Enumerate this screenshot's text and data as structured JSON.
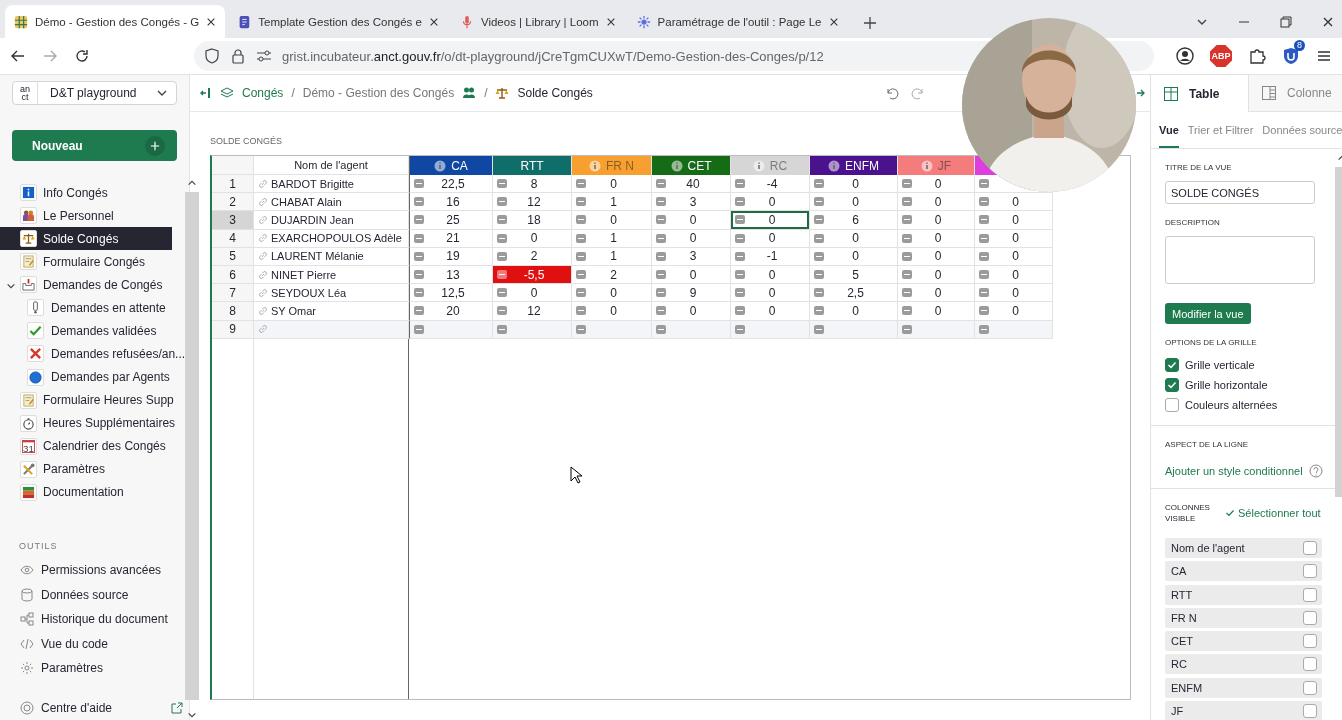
{
  "browser": {
    "tabs": [
      {
        "kind": "grid",
        "title": "Démo - Gestion des Congés - G",
        "selected": true
      },
      {
        "kind": "doc",
        "title": "Template Gestion des Congés e",
        "selected": false
      },
      {
        "kind": "mic",
        "title": "Videos | Library | Loom",
        "selected": false
      },
      {
        "kind": "sun",
        "title": "Paramétrage de l'outil : Page Le",
        "selected": false
      }
    ],
    "url": {
      "prefix": "grist.incubateur.",
      "domain": "anct.gouv.fr",
      "path": "/o/dt-playground/jCreTgmCUXwT/Demo-Gestion-des-Conges/p/12"
    },
    "adblock_label": "ABP",
    "extension_badge": "8"
  },
  "sidebar": {
    "logo": [
      "an",
      "ct"
    ],
    "org": "D&T playground",
    "new_button": "Nouveau",
    "pages": [
      {
        "kind": "info",
        "label": "Info Congés",
        "selected": false
      },
      {
        "kind": "people",
        "label": "Le Personnel",
        "selected": false
      },
      {
        "kind": "scale",
        "label": "Solde Congés",
        "selected": true
      },
      {
        "kind": "form",
        "label": "Formulaire Congés",
        "selected": false
      },
      {
        "kind": "inbox",
        "label": "Demandes de Congés",
        "selected": false,
        "expanded": true,
        "children": [
          {
            "kind": "exclaim",
            "label": "Demandes en attente",
            "selected": false
          },
          {
            "kind": "check",
            "label": "Demandes validées",
            "selected": false
          },
          {
            "kind": "cross",
            "label": "Demandes refusées/an...",
            "selected": false
          },
          {
            "kind": "circle",
            "label": "Demandes par Agents",
            "selected": false
          }
        ]
      },
      {
        "kind": "form",
        "label": "Formulaire Heures Supp",
        "selected": false
      },
      {
        "kind": "stopwatch",
        "label": "Heures Supplémentaires",
        "selected": false
      },
      {
        "kind": "calendar",
        "icon_text": "31",
        "label": "Calendrier des Congés",
        "selected": false
      },
      {
        "kind": "tools",
        "label": "Paramètres",
        "selected": false
      },
      {
        "kind": "books",
        "label": "Documentation",
        "selected": false
      }
    ],
    "tools_heading": "OUTILS",
    "tools": [
      {
        "kind": "eye",
        "label": "Permissions avancées"
      },
      {
        "kind": "database",
        "label": "Données source"
      },
      {
        "kind": "history",
        "label": "Historique du document"
      },
      {
        "kind": "code",
        "label": "Vue du code"
      },
      {
        "kind": "gear",
        "label": "Paramètres"
      }
    ],
    "help": "Centre d'aide"
  },
  "toolbar": {
    "crumbs": [
      {
        "kind": "workspace",
        "label": "Congés"
      },
      {
        "kind": "doc",
        "label": "Démo - Gestion des Congés"
      },
      {
        "kind": "page",
        "label": "Solde Congés"
      }
    ],
    "separators": [
      "/",
      "/"
    ]
  },
  "section_title": "SOLDE CONGÉS",
  "grid": {
    "columns": [
      {
        "kind": "text",
        "label": "Nom de l'agent"
      },
      {
        "kind": "number",
        "label": "CA",
        "color": "#0f47a3",
        "info": true,
        "faded": false
      },
      {
        "kind": "number",
        "label": "RTT",
        "color": "#0f6e6a",
        "info": false,
        "faded": false
      },
      {
        "kind": "number",
        "label": "FR N",
        "color": "#f7a030",
        "info": true,
        "faded": true
      },
      {
        "kind": "number",
        "label": "CET",
        "color": "#156b16",
        "info": true,
        "faded": false
      },
      {
        "kind": "number",
        "label": "RC",
        "color": "#d6d6d6",
        "info": true,
        "faded": true
      },
      {
        "kind": "number",
        "label": "ENFM",
        "color": "#4b128d",
        "info": true,
        "faded": false
      },
      {
        "kind": "number",
        "label": "JF",
        "color": "#f47c7c",
        "info": true,
        "faded": true
      },
      {
        "kind": "number",
        "color": "#dc3fdc"
      }
    ],
    "rows": [
      {
        "num": "1",
        "kind": "record",
        "selected": false,
        "cells": [
          {
            "value": "BARDOT  Brigitte",
            "alert": false,
            "focused": false
          },
          {
            "value": "22,5",
            "alert": false,
            "focused": false
          },
          {
            "value": "8",
            "alert": false,
            "focused": false
          },
          {
            "value": "0",
            "alert": false,
            "focused": false
          },
          {
            "value": "40",
            "alert": false,
            "focused": false
          },
          {
            "value": "-4",
            "alert": false,
            "focused": false
          },
          {
            "value": "0",
            "alert": false,
            "focused": false
          },
          {
            "value": "0",
            "alert": false,
            "focused": false
          },
          {
            "alert": false,
            "focused": false
          }
        ]
      },
      {
        "num": "2",
        "kind": "record",
        "selected": false,
        "cells": [
          {
            "value": "CHABAT Alain",
            "alert": false,
            "focused": false
          },
          {
            "value": "16",
            "alert": false,
            "focused": false
          },
          {
            "value": "12",
            "alert": false,
            "focused": false
          },
          {
            "value": "1",
            "alert": false,
            "focused": false
          },
          {
            "value": "3",
            "alert": false,
            "focused": false
          },
          {
            "value": "0",
            "alert": false,
            "focused": false
          },
          {
            "value": "0",
            "alert": false,
            "focused": false
          },
          {
            "value": "0",
            "alert": false,
            "focused": false
          },
          {
            "value": "0",
            "alert": false,
            "focused": false
          }
        ]
      },
      {
        "num": "3",
        "kind": "record",
        "selected": true,
        "cells": [
          {
            "value": "DUJARDIN Jean",
            "alert": false,
            "focused": false
          },
          {
            "value": "25",
            "alert": false,
            "focused": false
          },
          {
            "value": "18",
            "alert": false,
            "focused": false
          },
          {
            "value": "0",
            "alert": false,
            "focused": false
          },
          {
            "value": "0",
            "alert": false,
            "focused": false
          },
          {
            "value": "0",
            "alert": false,
            "focused": true
          },
          {
            "value": "6",
            "alert": false,
            "focused": false
          },
          {
            "value": "0",
            "alert": false,
            "focused": false
          },
          {
            "value": "0",
            "alert": false,
            "focused": false
          }
        ]
      },
      {
        "num": "4",
        "kind": "record",
        "selected": false,
        "cells": [
          {
            "value": "EXARCHOPOULOS Adèle",
            "alert": false,
            "focused": false
          },
          {
            "value": "21",
            "alert": false,
            "focused": false
          },
          {
            "value": "0",
            "alert": false,
            "focused": false
          },
          {
            "value": "1",
            "alert": false,
            "focused": false
          },
          {
            "value": "0",
            "alert": false,
            "focused": false
          },
          {
            "value": "0",
            "alert": false,
            "focused": false
          },
          {
            "value": "0",
            "alert": false,
            "focused": false
          },
          {
            "value": "0",
            "alert": false,
            "focused": false
          },
          {
            "value": "0",
            "alert": false,
            "focused": false
          }
        ]
      },
      {
        "num": "5",
        "kind": "record",
        "selected": false,
        "cells": [
          {
            "value": "LAURENT Mélanie",
            "alert": false,
            "focused": false
          },
          {
            "value": "19",
            "alert": false,
            "focused": false
          },
          {
            "value": "2",
            "alert": false,
            "focused": false
          },
          {
            "value": "1",
            "alert": false,
            "focused": false
          },
          {
            "value": "3",
            "alert": false,
            "focused": false
          },
          {
            "value": "-1",
            "alert": false,
            "focused": false
          },
          {
            "value": "0",
            "alert": false,
            "focused": false
          },
          {
            "value": "0",
            "alert": false,
            "focused": false
          },
          {
            "value": "0",
            "alert": false,
            "focused": false
          }
        ]
      },
      {
        "num": "6",
        "kind": "record",
        "selected": false,
        "cells": [
          {
            "value": "NINET Pierre",
            "alert": false,
            "focused": false
          },
          {
            "value": "13",
            "alert": false,
            "focused": false
          },
          {
            "value": "-5,5",
            "alert": true,
            "focused": false
          },
          {
            "value": "2",
            "alert": false,
            "focused": false
          },
          {
            "value": "0",
            "alert": false,
            "focused": false
          },
          {
            "value": "0",
            "alert": false,
            "focused": false
          },
          {
            "value": "5",
            "alert": false,
            "focused": false
          },
          {
            "value": "0",
            "alert": false,
            "focused": false
          },
          {
            "value": "0",
            "alert": false,
            "focused": false
          }
        ]
      },
      {
        "num": "7",
        "kind": "record",
        "selected": false,
        "cells": [
          {
            "value": "SEYDOUX Léa",
            "alert": false,
            "focused": false
          },
          {
            "value": "12,5",
            "alert": false,
            "focused": false
          },
          {
            "value": "0",
            "alert": false,
            "focused": false
          },
          {
            "value": "0",
            "alert": false,
            "focused": false
          },
          {
            "value": "9",
            "alert": false,
            "focused": false
          },
          {
            "value": "0",
            "alert": false,
            "focused": false
          },
          {
            "value": "2,5",
            "alert": false,
            "focused": false
          },
          {
            "value": "0",
            "alert": false,
            "focused": false
          },
          {
            "value": "0",
            "alert": false,
            "focused": false
          }
        ]
      },
      {
        "num": "8",
        "kind": "record",
        "selected": false,
        "cells": [
          {
            "value": "SY Omar",
            "alert": false,
            "focused": false
          },
          {
            "value": "20",
            "alert": false,
            "focused": false
          },
          {
            "value": "12",
            "alert": false,
            "focused": false
          },
          {
            "value": "0",
            "alert": false,
            "focused": false
          },
          {
            "value": "0",
            "alert": false,
            "focused": false
          },
          {
            "value": "0",
            "alert": false,
            "focused": false
          },
          {
            "value": "0",
            "alert": false,
            "focused": false
          },
          {
            "value": "0",
            "alert": false,
            "focused": false
          },
          {
            "value": "0",
            "alert": false,
            "focused": false
          }
        ]
      },
      {
        "num": "9",
        "kind": "new",
        "selected": false,
        "cells": [
          {
            "alert": false,
            "focused": false
          },
          {
            "alert": false,
            "focused": false
          },
          {
            "alert": false,
            "focused": false
          },
          {
            "alert": false,
            "focused": false
          },
          {
            "alert": false,
            "focused": false
          },
          {
            "alert": false,
            "focused": false
          },
          {
            "alert": false,
            "focused": false
          },
          {
            "alert": false,
            "focused": false
          },
          {
            "alert": false,
            "focused": false
          }
        ]
      }
    ]
  },
  "panel": {
    "tabs": [
      {
        "kind": "table",
        "label": "Table",
        "selected": true
      },
      {
        "kind": "column",
        "label": "Colonne",
        "selected": false
      }
    ],
    "subtabs": [
      {
        "label": "Vue",
        "selected": true
      },
      {
        "label": "Trier et Filtrer",
        "selected": false
      },
      {
        "label": "Données source",
        "selected": false
      }
    ],
    "title_label": "TITRE DE LA VUE",
    "title_value": "SOLDE CONGÉS",
    "description_label": "DESCRIPTION",
    "edit_button": "Modifier la vue",
    "grid_options_heading": "OPTIONS DE LA GRILLE",
    "grid_options": [
      {
        "label": "Grille verticale",
        "checked": true
      },
      {
        "label": "Grille horizontale",
        "checked": true
      },
      {
        "label": "Couleurs alternées",
        "checked": false
      }
    ],
    "row_style_heading": "ASPECT DE LA LIGNE",
    "row_style_link": "Ajouter un style conditionnel",
    "visible_heading": "COLONNES VISIBLE",
    "select_all": "Sélectionner tout",
    "visible_columns": [
      {
        "label": "Nom de l'agent",
        "checked": false
      },
      {
        "label": "CA",
        "checked": false
      },
      {
        "label": "RTT",
        "checked": false
      },
      {
        "label": "FR N",
        "checked": false
      },
      {
        "label": "CET",
        "checked": false
      },
      {
        "label": "RC",
        "checked": false
      },
      {
        "label": "ENFM",
        "checked": false
      },
      {
        "label": "JF",
        "checked": false
      }
    ]
  }
}
